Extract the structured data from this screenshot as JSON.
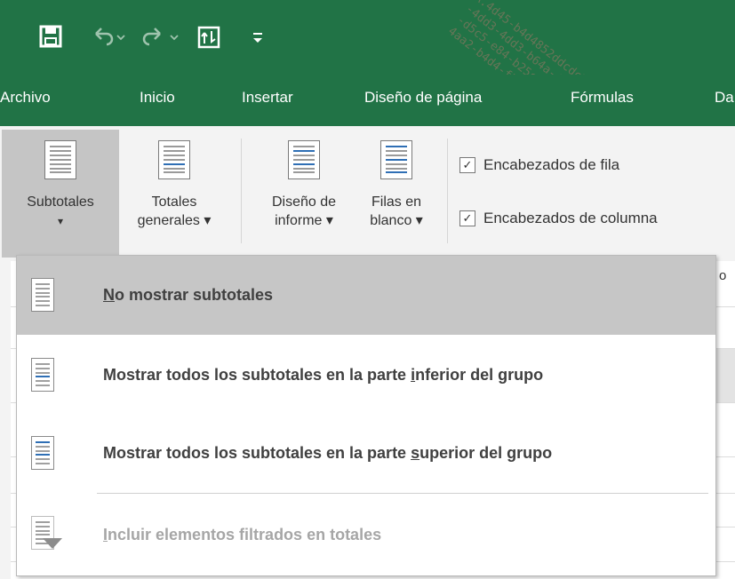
{
  "qat": {
    "save_icon": "save-icon",
    "undo_icon": "undo-icon",
    "redo_icon": "redo-icon",
    "touch_icon": "touch-mode-icon",
    "customize_icon": "customize-qat-icon"
  },
  "tabs": [
    "Archivo",
    "Inicio",
    "Insertar",
    "Diseño de página",
    "Fórmulas",
    "Da"
  ],
  "ribbon": {
    "subtotales": {
      "line1": "Subtotales",
      "line2": "▾"
    },
    "totales": {
      "line1": "Totales",
      "line2": "generales ▾"
    },
    "diseno": {
      "line1": "Diseño de",
      "line2": "informe ▾"
    },
    "filas": {
      "line1": "Filas en",
      "line2": "blanco ▾"
    },
    "check_fila": "Encabezados de fila",
    "check_columna": "Encabezados de columna",
    "peek_text": "o"
  },
  "menu": {
    "item1_ul": "N",
    "item1_rest": "o mostrar subtotales",
    "item2_pre": "Mostrar todos los subtotales en la parte ",
    "item2_ul": "i",
    "item2_post": "nferior del grupo",
    "item3_pre": "Mostrar todos los subtotales en la parte ",
    "item3_ul": "s",
    "item3_post": "uperior del grupo",
    "item4_ul": "I",
    "item4_rest": "ncluir elementos filtrados en totales"
  },
  "colors": {
    "excel_green": "#217346",
    "selected_gray": "#c6c6c6",
    "disabled_text": "#a6a6a6"
  }
}
